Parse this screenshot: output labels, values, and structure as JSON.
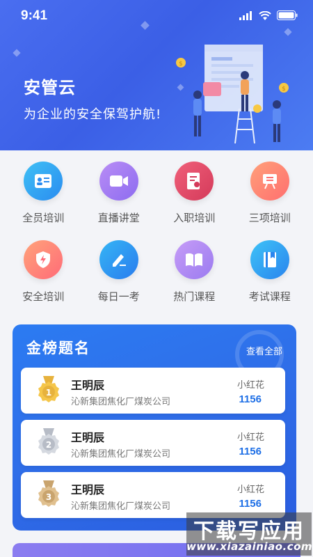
{
  "status_bar": {
    "time": "9:41"
  },
  "header": {
    "title": "安管云",
    "slogan": "为企业的安全保驾护航!"
  },
  "grid": {
    "row1": [
      {
        "label": "全员培训",
        "icon": "id-card-icon",
        "colors": [
          "#3fc0f5",
          "#2a8cf0"
        ]
      },
      {
        "label": "直播讲堂",
        "icon": "video-camera-icon",
        "colors": [
          "#b98df5",
          "#8d6cf0"
        ]
      },
      {
        "label": "入职培训",
        "icon": "document-badge-icon",
        "colors": [
          "#f0607a",
          "#d43a5a"
        ]
      },
      {
        "label": "三项培训",
        "icon": "easel-board-icon",
        "colors": [
          "#ffa07a",
          "#ff6f6f"
        ]
      }
    ],
    "row2": [
      {
        "label": "安全培训",
        "icon": "shield-bolt-icon",
        "colors": [
          "#ffa37a",
          "#ff6b78"
        ]
      },
      {
        "label": "每日一考",
        "icon": "pencil-icon",
        "colors": [
          "#35b5f5",
          "#2a7cee"
        ]
      },
      {
        "label": "热门课程",
        "icon": "open-book-icon",
        "colors": [
          "#c69cf7",
          "#9b7bf0"
        ]
      },
      {
        "label": "考试课程",
        "icon": "bookmark-book-icon",
        "colors": [
          "#3ec3f7",
          "#2a84ee"
        ]
      }
    ]
  },
  "ranking": {
    "title": "金榜题名",
    "more_label": "查看全部",
    "rows": [
      {
        "rank": "1",
        "medal": "gold-medal-icon",
        "name": "王明辰",
        "org": "沁新集团焦化厂煤炭公司",
        "user": "小红花",
        "score": "1156"
      },
      {
        "rank": "2",
        "medal": "silver-medal-icon",
        "name": "王明辰",
        "org": "沁新集团焦化厂煤炭公司",
        "user": "小红花",
        "score": "1156"
      },
      {
        "rank": "3",
        "medal": "bronze-medal-icon",
        "name": "王明辰",
        "org": "沁新集团焦化厂煤炭公司",
        "user": "小红花",
        "score": "1156"
      }
    ]
  },
  "watermark": {
    "main": "下载写应用",
    "sub": "www.xiazainiao.com"
  },
  "colors": {
    "header_blue": "#3b5fe6",
    "rank_blue": "#2c7bf2",
    "score_blue": "#1e6fe6"
  }
}
